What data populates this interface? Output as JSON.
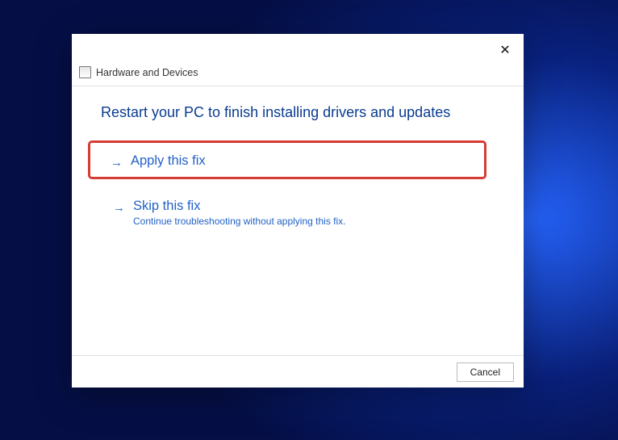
{
  "dialog": {
    "title": "Hardware and Devices",
    "heading": "Restart your PC to finish installing drivers and updates"
  },
  "options": {
    "apply": {
      "label": "Apply this fix"
    },
    "skip": {
      "label": "Skip this fix",
      "sub": "Continue troubleshooting without applying this fix."
    }
  },
  "footer": {
    "cancel": "Cancel"
  },
  "colors": {
    "link": "#2362c7",
    "highlight_border": "#d63b34"
  }
}
